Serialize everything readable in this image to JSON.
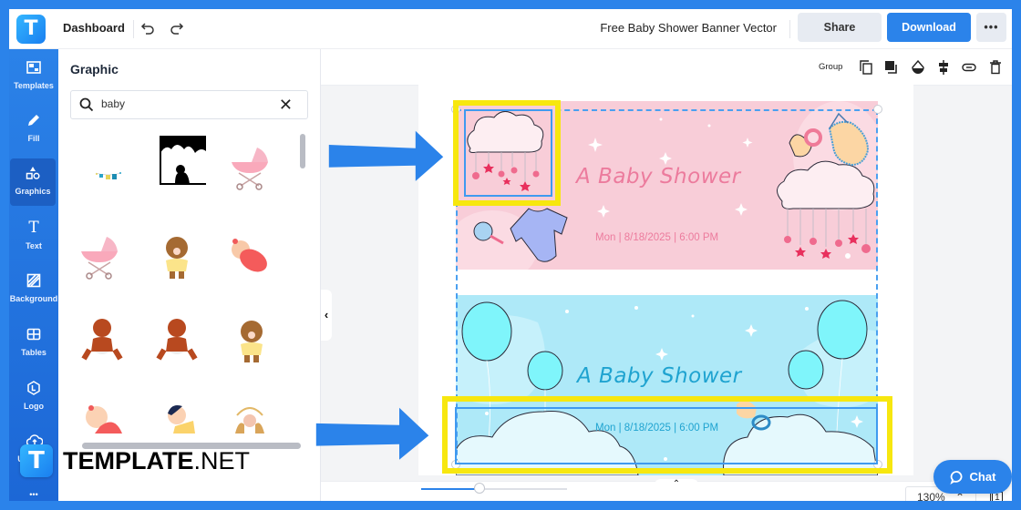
{
  "topbar": {
    "logo_letter": "T",
    "dashboard_label": "Dashboard",
    "undo_icon": "undo-icon",
    "redo_icon": "redo-icon",
    "document_title": "Free Baby Shower Banner Vector",
    "share_label": "Share",
    "download_label": "Download",
    "more_label": "•••"
  },
  "sidebar": {
    "items": [
      {
        "label": "Templates",
        "icon": "templates-icon",
        "active": false
      },
      {
        "label": "Fill",
        "icon": "pencil-icon",
        "active": false
      },
      {
        "label": "Graphics",
        "icon": "shapes-icon",
        "active": true
      },
      {
        "label": "Text",
        "icon": "text-icon",
        "active": false
      },
      {
        "label": "Background",
        "icon": "background-icon",
        "active": false
      },
      {
        "label": "Tables",
        "icon": "table-icon",
        "active": false
      },
      {
        "label": "Logo",
        "icon": "logo-icon",
        "active": false
      },
      {
        "label": "Uploads",
        "icon": "upload-cloud-icon",
        "active": false
      }
    ],
    "more_label": "•••"
  },
  "panel": {
    "title": "Graphic",
    "search_value": "baby",
    "search_placeholder": "Search",
    "thumbnails": [
      "baby-clothes-garland",
      "mother-child-silhouette",
      "pink-stroller",
      "pink-stroller",
      "baby-with-pacifier",
      "swaddled-baby",
      "sitting-baby",
      "sitting-baby",
      "baby-with-pacifier",
      "sleeping-baby",
      "crawling-baby",
      "baby-in-manger"
    ]
  },
  "toolbar": {
    "group_label": "Group",
    "tools": [
      "duplicate-icon",
      "layer-icon",
      "opacity-icon",
      "align-icon",
      "link-icon",
      "trash-icon"
    ]
  },
  "canvas": {
    "banners": [
      {
        "title": "A Baby Shower",
        "date": "Mon | 8/18/2025 | 6:00 PM",
        "background": "#f8cdd8",
        "text_color": "#ec7b9d"
      },
      {
        "title": "A Baby Shower",
        "date": "Mon | 8/18/2025 | 6:00 PM",
        "background": "#aee9f8",
        "text_color": "#1fa3d0"
      }
    ],
    "highlight_color": "#f7e70f",
    "selection_color": "#3f9af0"
  },
  "bottombar": {
    "zoom_level": "130%",
    "zoom_fraction": 0.4,
    "page_count": "1"
  },
  "chat": {
    "label": "Chat"
  },
  "watermark": {
    "bold": "TEMPLATE",
    "light": ".NET",
    "logo_letter": "T"
  }
}
